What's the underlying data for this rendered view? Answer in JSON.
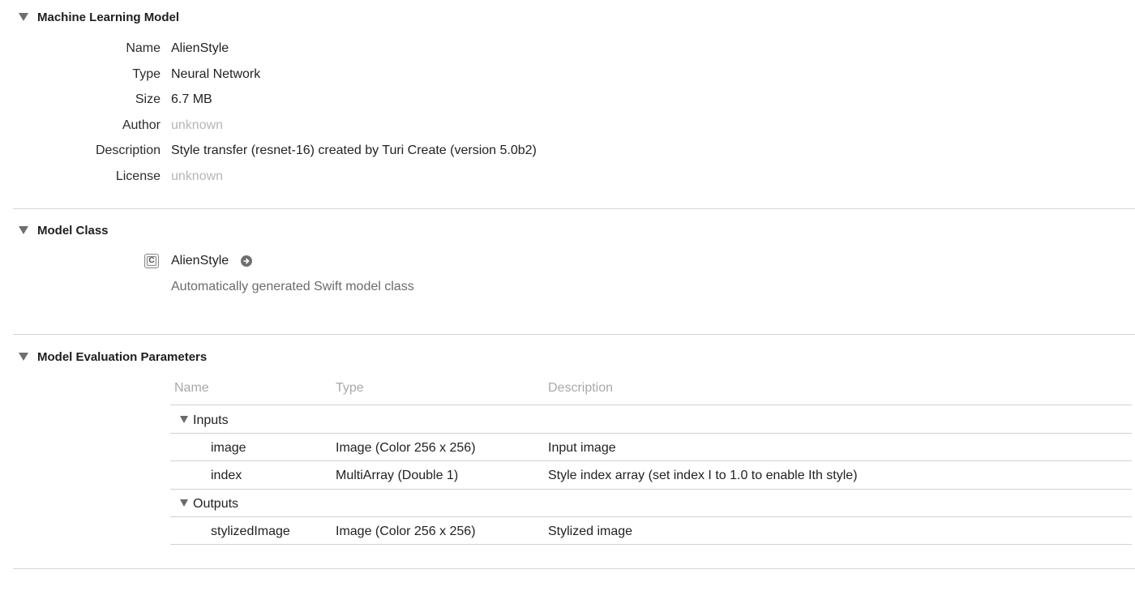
{
  "mlm": {
    "title": "Machine Learning Model",
    "fields": [
      {
        "label": "Name",
        "value": "AlienStyle"
      },
      {
        "label": "Type",
        "value": "Neural Network"
      },
      {
        "label": "Size",
        "value": "6.7 MB"
      },
      {
        "label": "Author",
        "value": "unknown"
      },
      {
        "label": "Description",
        "value": "Style transfer (resnet-16) created by Turi Create (version 5.0b2)"
      },
      {
        "label": "License",
        "value": "unknown"
      }
    ]
  },
  "model_class": {
    "title": "Model Class",
    "class_name": "AlienStyle",
    "icon_letter": "C",
    "subtitle": "Automatically generated Swift model class"
  },
  "eval": {
    "title": "Model Evaluation Parameters",
    "columns": [
      "Name",
      "Type",
      "Description"
    ],
    "groups": [
      {
        "name": "Inputs",
        "rows": [
          {
            "name": "image",
            "type": "Image (Color 256 x 256)",
            "description": "Input image"
          },
          {
            "name": "index",
            "type": "MultiArray (Double 1)",
            "description": "Style index array (set index I to 1.0 to enable Ith style)"
          }
        ]
      },
      {
        "name": "Outputs",
        "rows": [
          {
            "name": "stylizedImage",
            "type": "Image (Color 256 x 256)",
            "description": "Stylized image"
          }
        ]
      }
    ]
  }
}
